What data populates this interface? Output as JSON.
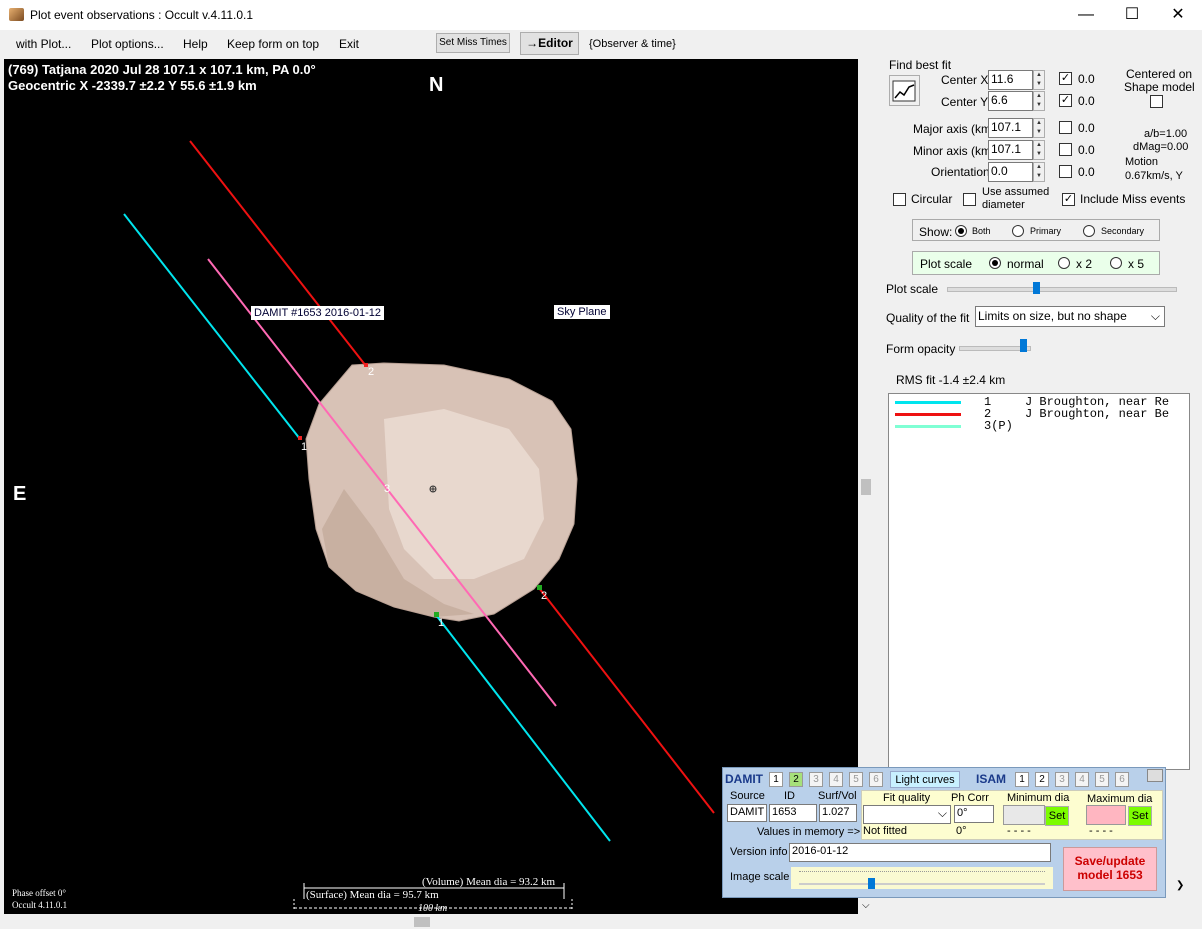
{
  "window": {
    "title": "Plot event observations : Occult v.4.11.0.1",
    "minimize": "—",
    "maximize": "☐",
    "close": "✕"
  },
  "menu": {
    "with_plot": "with Plot...",
    "plot_options": "Plot options...",
    "help": "Help",
    "keep_on_top": "Keep form on top",
    "exit": "Exit",
    "set_miss_times": "Set Miss Times",
    "editor": "→Editor",
    "observer_time": "{Observer & time}"
  },
  "plot": {
    "header1": "(769) Tatjana  2020 Jul 28  107.1 x 107.1 km, PA 0.0°",
    "header2": "Geocentric  X  -2339.7 ±2.2  Y 55.6 ±1.9 km",
    "north": "N",
    "east": "E",
    "damit_label": "DAMIT #1653 2016-01-12",
    "sky_plane": "Sky Plane",
    "chord_labels": {
      "c1a": "1",
      "c1b": "1",
      "c2a": "2",
      "c2b": "2",
      "c3": "3"
    },
    "volume_dia": "(Volume) Mean dia = 93.2 km",
    "surface_dia": "(Surface) Mean dia = 95.7 km",
    "scale_bar": "100 km",
    "phase_offset": "Phase offset 0°",
    "version": "Occult 4.11.0.1"
  },
  "fit": {
    "find_best_fit": "Find best fit",
    "center_x_label": "Center X",
    "center_x": "11.6",
    "center_x_check": "0.0",
    "center_y_label": "Center Y",
    "center_y": "6.6",
    "center_y_check": "0.0",
    "major_label": "Major axis (km)",
    "major": "107.1",
    "major_check": "0.0",
    "minor_label": "Minor axis (km)",
    "minor": "107.1",
    "minor_check": "0.0",
    "orient_label": "Orientation",
    "orient": "0.0",
    "orient_check": "0.0",
    "centered_on": "Centered on",
    "shape_model": "Shape model",
    "ab": "a/b=1.00",
    "dmag": "dMag=0.00",
    "motion": "Motion",
    "motion_val": "0.67km/s, Y",
    "circular": "Circular",
    "use_assumed_1": "Use assumed",
    "use_assumed_2": "diameter",
    "include_miss": "Include Miss events",
    "show_label": "Show:",
    "both": "Both",
    "primary": "Primary",
    "secondary": "Secondary",
    "plot_scale_label": "Plot scale",
    "normal": "normal",
    "x2": "x 2",
    "x5": "x 5",
    "plot_scale_slider": "Plot scale",
    "quality_label": "Quality of the fit",
    "quality_value": "Limits on size, but no shape",
    "form_opacity": "Form opacity",
    "rms": "RMS fit -1.4 ±2.4 km"
  },
  "observers": [
    {
      "num": "1",
      "name": "J Broughton, near Re",
      "color": "#00e5ee"
    },
    {
      "num": "2",
      "name": "J Broughton, near Be",
      "color": "#ee1111"
    },
    {
      "num": "3(P)",
      "name": "",
      "color": "#7fffd4"
    }
  ],
  "damit": {
    "title": "DAMIT",
    "nums": [
      "1",
      "2",
      "3",
      "4",
      "5",
      "6"
    ],
    "light_curves": "Light curves",
    "isam": "ISAM",
    "isam_nums": [
      "1",
      "2",
      "3",
      "4",
      "5",
      "6"
    ],
    "source_label": "Source",
    "id_label": "ID",
    "surfvol_label": "Surf/Vol",
    "source": "DAMIT",
    "id": "1653",
    "surfvol": "1.027",
    "values_mem": "Values in memory =>",
    "fit_quality": "Fit quality",
    "ph_corr": "Ph Corr",
    "min_dia": "Minimum dia",
    "max_dia": "Maximum dia",
    "ph_corr_val": "0°",
    "not_fitted": "Not fitted",
    "ph_corr_mem": "0°",
    "dashes1": "- - - -",
    "dashes2": "- - - -",
    "set": "Set",
    "version_label": "Version info",
    "version": "2016-01-12",
    "image_scale": "Image scale",
    "save": "Save/update model  1653"
  }
}
